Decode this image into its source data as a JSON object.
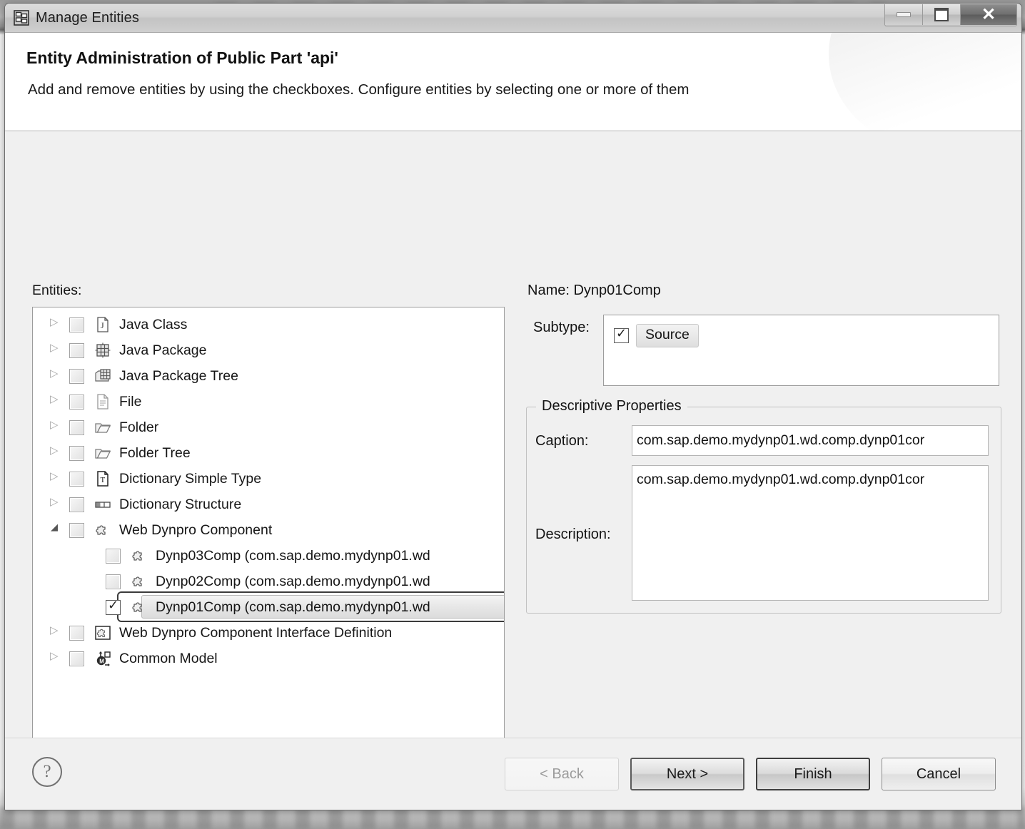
{
  "window": {
    "title": "Manage Entities",
    "icon": "manage-entities-icon",
    "controls": {
      "minimize": "Minimize",
      "maximize": "Maximize",
      "close": "Close"
    }
  },
  "header": {
    "title": "Entity Administration of Public Part 'api'",
    "description": "Add and remove entities by using the checkboxes. Configure entities by selecting one or more of them"
  },
  "left": {
    "entities_label": "Entities:",
    "tree": [
      {
        "label": "Java Class",
        "icon": "java-class-icon",
        "twisty": "collapsed",
        "checked": false,
        "child": false,
        "selected": false
      },
      {
        "label": "Java Package",
        "icon": "java-package-icon",
        "twisty": "collapsed",
        "checked": false,
        "child": false,
        "selected": false
      },
      {
        "label": "Java Package Tree",
        "icon": "java-package-tree-icon",
        "twisty": "collapsed",
        "checked": false,
        "child": false,
        "selected": false
      },
      {
        "label": "File",
        "icon": "file-icon",
        "twisty": "collapsed",
        "checked": false,
        "child": false,
        "selected": false
      },
      {
        "label": "Folder",
        "icon": "folder-icon",
        "twisty": "collapsed",
        "checked": false,
        "child": false,
        "selected": false
      },
      {
        "label": "Folder Tree",
        "icon": "folder-tree-icon",
        "twisty": "collapsed",
        "checked": false,
        "child": false,
        "selected": false
      },
      {
        "label": "Dictionary Simple Type",
        "icon": "dictionary-simple-type-icon",
        "twisty": "collapsed",
        "checked": false,
        "child": false,
        "selected": false
      },
      {
        "label": "Dictionary Structure",
        "icon": "dictionary-structure-icon",
        "twisty": "collapsed",
        "checked": false,
        "child": false,
        "selected": false
      },
      {
        "label": "Web Dynpro Component",
        "icon": "web-dynpro-component-icon",
        "twisty": "expanded",
        "checked": false,
        "child": false,
        "selected": false
      },
      {
        "label": "Dynp03Comp (com.sap.demo.mydynp01.wd",
        "icon": "web-dynpro-component-icon",
        "twisty": "none",
        "checked": false,
        "child": true,
        "selected": false
      },
      {
        "label": "Dynp02Comp (com.sap.demo.mydynp01.wd",
        "icon": "web-dynpro-component-icon",
        "twisty": "none",
        "checked": false,
        "child": true,
        "selected": false
      },
      {
        "label": "Dynp01Comp (com.sap.demo.mydynp01.wd",
        "icon": "web-dynpro-component-icon",
        "twisty": "none",
        "checked": true,
        "child": true,
        "selected": true
      },
      {
        "label": "Web Dynpro Component Interface Definition",
        "icon": "web-dynpro-interface-icon",
        "twisty": "collapsed",
        "checked": false,
        "child": false,
        "selected": false
      },
      {
        "label": "Common Model",
        "icon": "common-model-icon",
        "twisty": "collapsed",
        "checked": false,
        "child": false,
        "selected": false
      }
    ],
    "scrollbar": {
      "left_arrow": "◀",
      "right_arrow": "▶",
      "grip": "llll"
    }
  },
  "right": {
    "name_line": "Name: Dynp01Comp",
    "subtype_label": "Subtype:",
    "subtype_items": [
      {
        "label": "Source",
        "checked": true
      }
    ],
    "group_title": "Descriptive Properties",
    "caption_label": "Caption:",
    "caption_value": "com.sap.demo.mydynp01.wd.comp.dynp01cor",
    "description_label": "Description:",
    "description_value": "com.sap.demo.mydynp01.wd.comp.dynp01cor"
  },
  "footer": {
    "help": "?",
    "buttons": [
      {
        "label": "< Back",
        "state": "disabled"
      },
      {
        "label": "Next >",
        "state": "default"
      },
      {
        "label": "Finish",
        "state": "strong"
      },
      {
        "label": "Cancel",
        "state": "plain"
      }
    ]
  },
  "colors": {
    "dialog_bg": "#f0f0f0",
    "panel_bg": "#ffffff",
    "border": "#9c9c9c",
    "text": "#141414",
    "disabled_text": "#9c9c9c"
  }
}
